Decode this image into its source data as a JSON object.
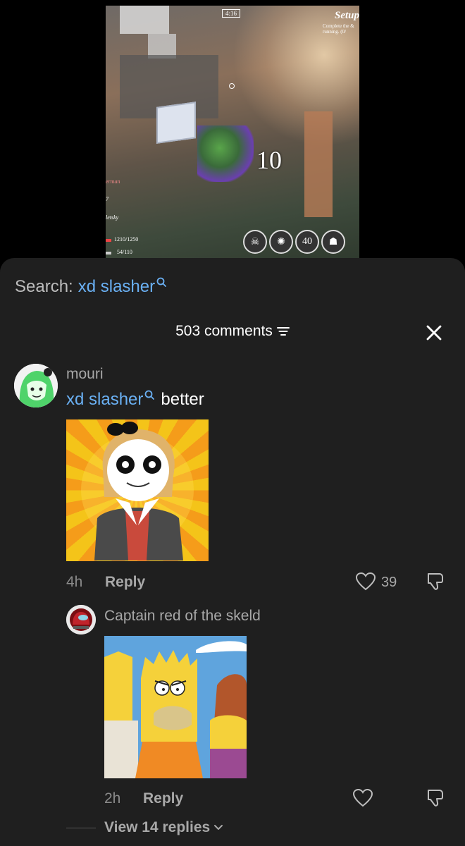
{
  "video": {
    "timer": "4:16",
    "objective_title": "Setup",
    "objective_text": "Complete the & running. (0/",
    "damage_number": "10",
    "hud_names": [
      "erman",
      "7",
      "letsky"
    ],
    "health": "1210/1250",
    "stamina": "54/110",
    "ability_value": "40"
  },
  "search": {
    "prefix": "Search:",
    "term": "xd slasher"
  },
  "header": {
    "comments_count": "503 comments"
  },
  "comment": {
    "username": "mouri",
    "link_text": "xd slasher",
    "text": "better",
    "time": "4h",
    "reply_label": "Reply",
    "likes": "39"
  },
  "reply": {
    "username": "Captain red of the skeld",
    "time": "2h",
    "reply_label": "Reply"
  },
  "view_replies": "View 14 replies",
  "colors": {
    "panel_bg": "#1f1f1f",
    "link": "#6ab0f3",
    "muted": "#a8a8a8"
  }
}
